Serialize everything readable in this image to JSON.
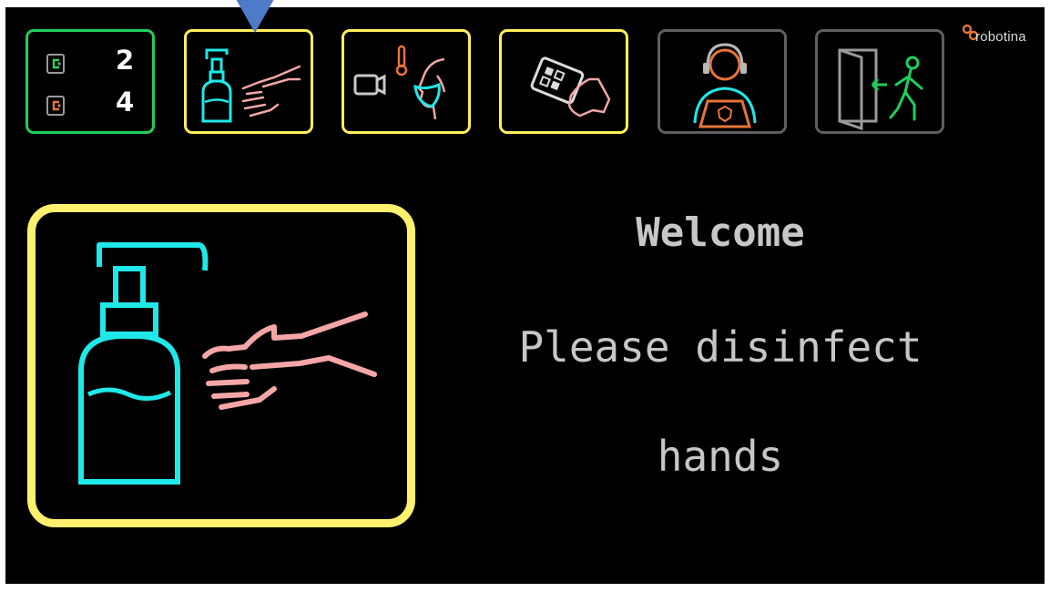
{
  "counter": {
    "first_value": "2",
    "second_value": "4",
    "icons": [
      "door-entry-icon",
      "door-exit-icon"
    ]
  },
  "steps": [
    {
      "name": "disinfect-hands",
      "icon": "hand-sanitizer-icon",
      "state": "active"
    },
    {
      "name": "temperature-and-mask",
      "icon": "temperature-mask-camera-icon",
      "state": "pending"
    },
    {
      "name": "ticket-scan",
      "icon": "qr-ticket-icon",
      "state": "pending"
    },
    {
      "name": "operator-assistance",
      "icon": "operator-headset-icon",
      "state": "inactive"
    },
    {
      "name": "exit",
      "icon": "exit-door-icon",
      "state": "inactive"
    }
  ],
  "brand": {
    "name": "robotina",
    "icon": "robotina-logo-icon"
  },
  "message": {
    "welcome": "Welcome",
    "instruction_line1": "Please disinfect",
    "instruction_line2": "hands"
  },
  "colors": {
    "background": "#000000",
    "active_frame": "#ffef5a",
    "counter_frame": "#1fcf5c",
    "inactive_frame": "#5f5f5f",
    "bottle": "#1fe8e8",
    "hand": "#f4a6a6",
    "text": "#c7c7c7",
    "marker": "#4f79c9"
  }
}
